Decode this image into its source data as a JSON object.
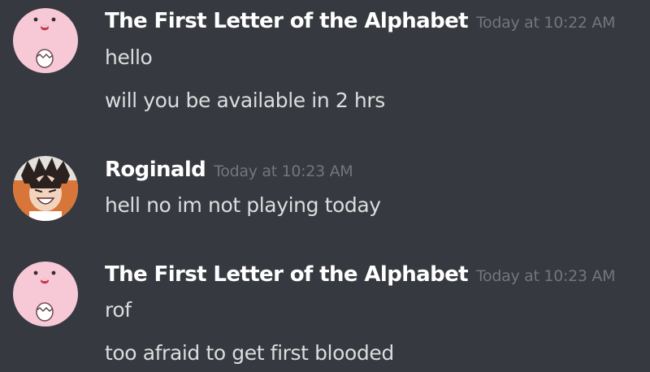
{
  "messages": [
    {
      "author": "The First Letter of the Alphabet",
      "timestamp": "Today at 10:22 AM",
      "lines": [
        "hello",
        "will you be available in 2 hrs"
      ],
      "avatar_icon": "pink-egg-creature-icon"
    },
    {
      "author": "Roginald",
      "timestamp": "Today at 10:23 AM",
      "lines": [
        "hell no im not playing today"
      ],
      "avatar_icon": "anime-character-avatar"
    },
    {
      "author": "The First Letter of the Alphabet",
      "timestamp": "Today at 10:23 AM",
      "lines": [
        "rof",
        "too afraid to get first blooded"
      ],
      "avatar_icon": "pink-egg-creature-icon"
    }
  ],
  "colors": {
    "background": "#36393f",
    "username": "#ffffff",
    "timestamp": "#72767d",
    "message_text": "#dcddde",
    "avatar_pink": "#f7c8d5"
  }
}
